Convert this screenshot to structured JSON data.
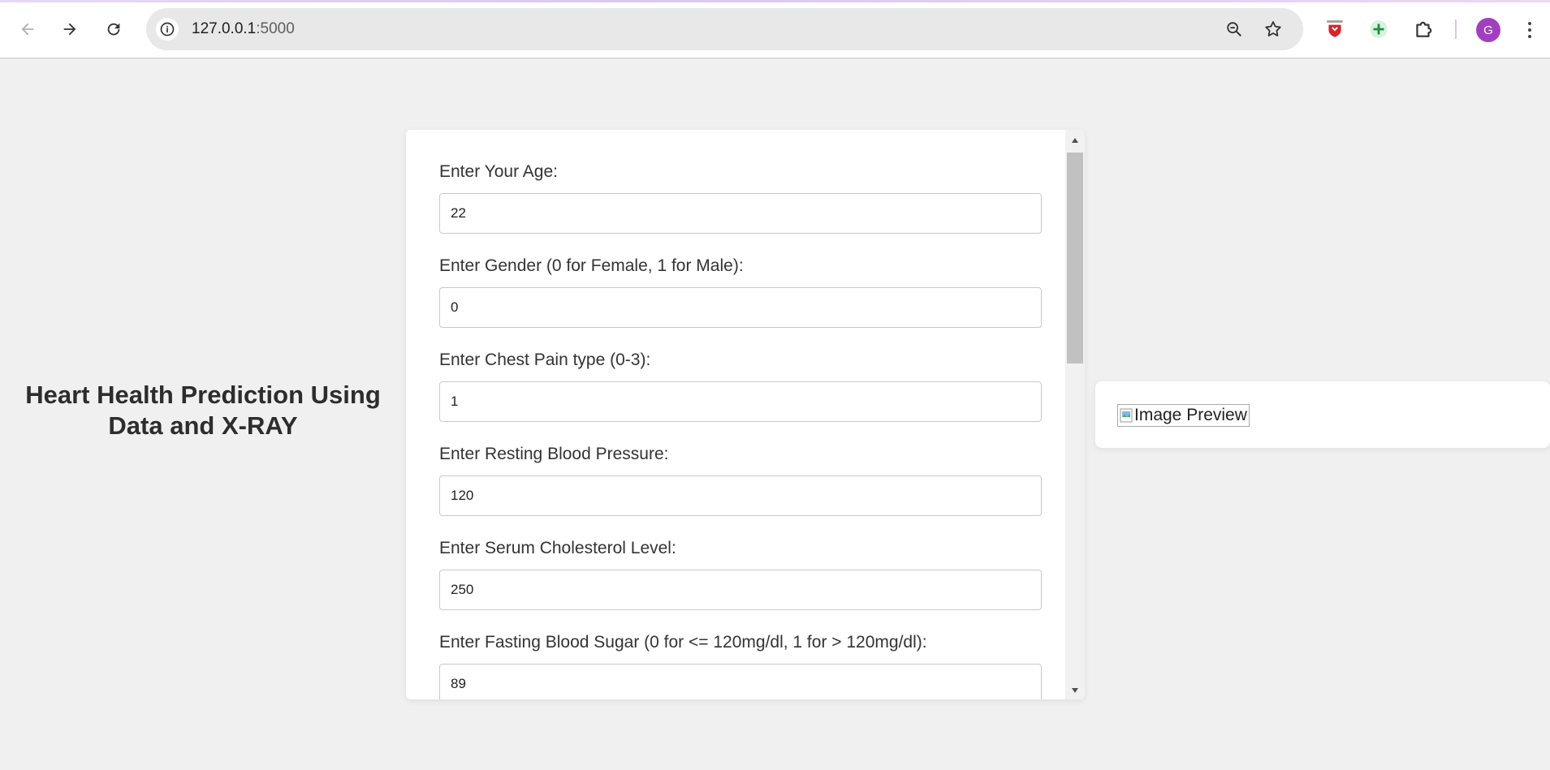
{
  "browser": {
    "url_host": "127.0.0.1",
    "url_port": ":5000"
  },
  "page": {
    "title": "Heart Health Prediction Using Data and X-RAY"
  },
  "form": {
    "fields": [
      {
        "label": "Enter Your Age:",
        "value": "22"
      },
      {
        "label": "Enter Gender (0 for Female, 1 for Male):",
        "value": "0"
      },
      {
        "label": "Enter Chest Pain type (0-3):",
        "value": "1"
      },
      {
        "label": "Enter Resting Blood Pressure:",
        "value": "120"
      },
      {
        "label": "Enter Serum Cholesterol Level:",
        "value": "250"
      },
      {
        "label": "Enter Fasting Blood Sugar (0 for <= 120mg/dl, 1 for > 120mg/dl):",
        "value": "89"
      }
    ]
  },
  "preview": {
    "alt_text": "Image Preview"
  },
  "profile": {
    "initial": "G"
  },
  "colors": {
    "background": "#f0f0f0",
    "avatar": "#a23fbf",
    "card": "#ffffff"
  }
}
